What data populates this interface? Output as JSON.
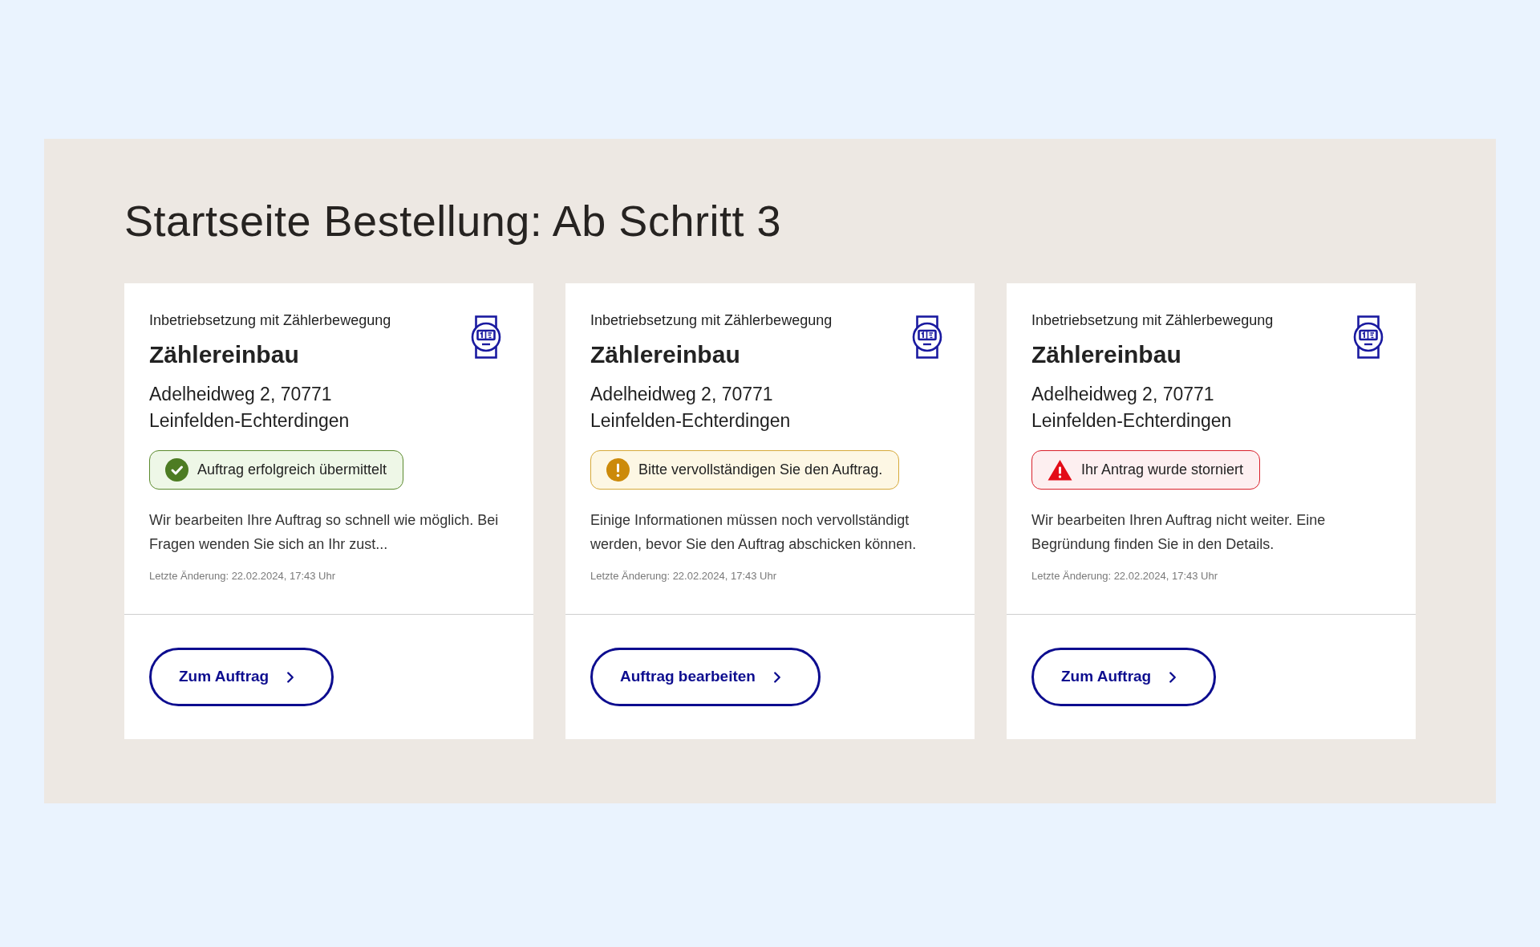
{
  "page": {
    "title": "Startseite Bestellung: Ab Schritt 3"
  },
  "cards": [
    {
      "category": "Inbetriebsetzung mit Zählerbewegung",
      "title": "Zählereinbau",
      "address_lines": [
        "Adelheidweg 2, 70771",
        "Leinfelden-Echterdingen"
      ],
      "status": {
        "kind": "success",
        "text": "Auftrag erfolgreich übermittelt"
      },
      "description": "Wir bearbeiten Ihre Auftrag so schnell wie möglich. Bei Fragen wenden Sie sich an Ihr zust...",
      "last_change": "Letzte Änderung: 22.02.2024, 17:43 Uhr",
      "button": "Zum Auftrag"
    },
    {
      "category": "Inbetriebsetzung mit Zählerbewegung",
      "title": "Zählereinbau",
      "address_lines": [
        "Adelheidweg 2, 70771",
        "Leinfelden-Echterdingen"
      ],
      "status": {
        "kind": "warning",
        "text": "Bitte vervollständigen Sie den Auftrag."
      },
      "description": "Einige Informationen müssen noch vervollständigt werden, bevor Sie den Auftrag abschicken können.",
      "last_change": "Letzte Änderung: 22.02.2024, 17:43 Uhr",
      "button": "Auftrag bearbeiten"
    },
    {
      "category": "Inbetriebsetzung mit Zählerbewegung",
      "title": "Zählereinbau",
      "address_lines": [
        "Adelheidweg 2, 70771",
        "Leinfelden-Echterdingen"
      ],
      "status": {
        "kind": "error",
        "text": "Ihr Antrag wurde storniert"
      },
      "description": "Wir bearbeiten Ihren Auftrag nicht weiter. Eine Begründung finden Sie in den Details.",
      "last_change": "Letzte Änderung: 22.02.2024, 17:43 Uhr",
      "button": "Zum Auftrag"
    }
  ]
}
